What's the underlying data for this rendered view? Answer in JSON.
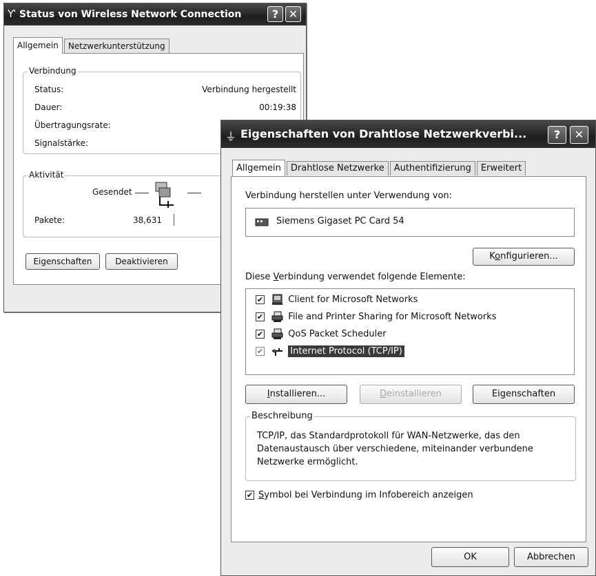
{
  "status_window": {
    "title": "Status von Wireless Network Connection",
    "tabs": [
      "Allgemein",
      "Netzwerkunterstützung"
    ],
    "connection": {
      "legend": "Verbindung",
      "status_label": "Status:",
      "status_value": "Verbindung hergestellt",
      "duration_label": "Dauer:",
      "duration_value": "00:19:38",
      "rate_label": "Übertragungsrate:",
      "signal_label": "Signalstärke:"
    },
    "activity": {
      "legend": "Aktivität",
      "sent_label": "Gesendet",
      "packets_label": "Pakete:",
      "packets_sent": "38,631"
    },
    "buttons": {
      "properties": "Eigenschaften",
      "deactivate": "Deaktivieren"
    }
  },
  "properties_window": {
    "title": "Eigenschaften von Drahtlose Netzwerkverbi...",
    "tabs": [
      "Allgemein",
      "Drahtlose Netzwerke",
      "Authentifizierung",
      "Erweitert"
    ],
    "connect_using_label": "Verbindung herstellen unter Verwendung von:",
    "adapter_name": "Siemens Gigaset PC Card 54",
    "configure_button": {
      "pre": "K",
      "ul": "o",
      "post": "nfigurieren..."
    },
    "components_label": {
      "pre": "Diese ",
      "ul": "V",
      "post": "erbindung verwendet folgende Elemente:"
    },
    "components": [
      {
        "label": "Client for Microsoft Networks",
        "checked": true,
        "icon": "client-icon"
      },
      {
        "label": "File and Printer Sharing for Microsoft Networks",
        "checked": true,
        "icon": "printer-sharing-icon"
      },
      {
        "label": "QoS Packet Scheduler",
        "checked": true,
        "icon": "scheduler-icon"
      },
      {
        "label": "Internet Protocol (TCP/IP)",
        "checked": true,
        "icon": "protocol-icon",
        "selected": true
      }
    ],
    "install_button": {
      "pre": "",
      "ul": "I",
      "post": "nstallieren..."
    },
    "uninstall_button": {
      "pre": "",
      "ul": "D",
      "post": "einstallieren"
    },
    "properties_button": {
      "pre": "Ei",
      "ul": "g",
      "post": "enschaften"
    },
    "description": {
      "legend": "Beschreibung",
      "line1": "TCP/IP, das Standardprotokoll für WAN-Netzwerke, das den",
      "line2": "Datenaustausch über verschiedene, miteinander verbundene",
      "line3": "Netzwerke ermöglicht."
    },
    "show_icon_checkbox": {
      "checked": true,
      "ul": "S",
      "post": "ymbol bei Verbindung im Infobereich anzeigen"
    },
    "ok_button": "OK",
    "cancel_button": "Abbrechen"
  },
  "colors": {
    "titlebar": "#2c2c2c",
    "selection": "#3a3a3a",
    "window_bg": "#ececec"
  }
}
